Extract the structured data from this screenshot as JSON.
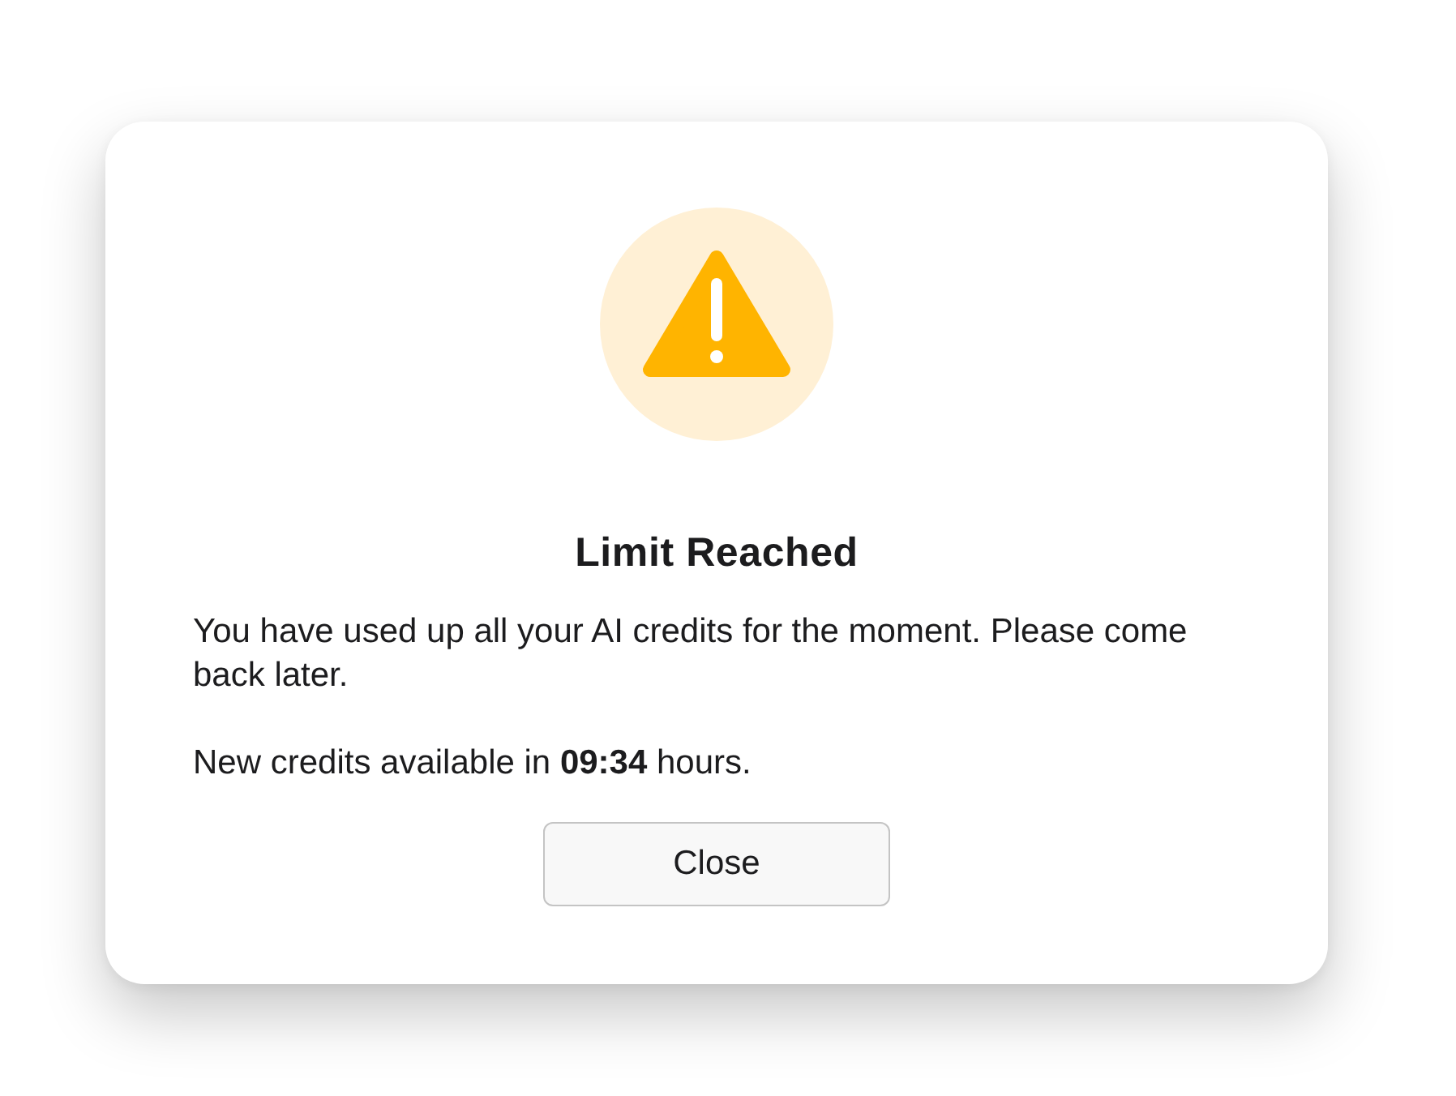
{
  "dialog": {
    "title": "Limit Reached",
    "message": "You have used up all your AI credits for the moment. Please come back later.",
    "availability": "New credits available in **09:34** hours.",
    "buttons": [
      {
        "label": "Close"
      }
    ]
  }
}
